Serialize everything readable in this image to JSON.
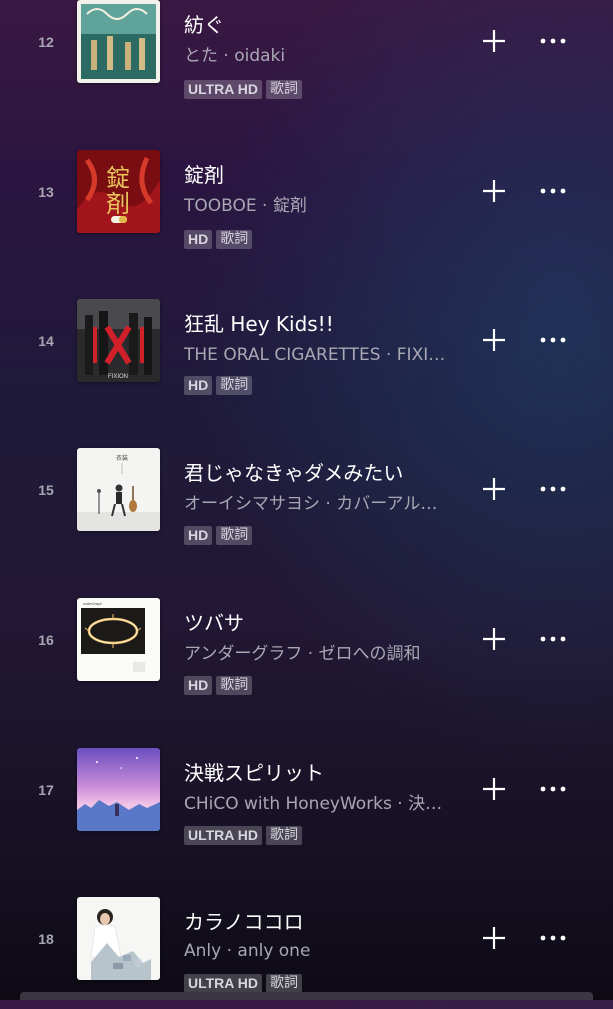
{
  "tracks": [
    {
      "number": "12",
      "title": "紡ぐ",
      "subtitle": "とた · oidaki",
      "quality": "ULTRA HD",
      "lyrics": "歌詞",
      "art": "album-art-oidaki"
    },
    {
      "number": "13",
      "title": "錠剤",
      "subtitle": "TOOBOE · 錠剤",
      "quality": "HD",
      "lyrics": "歌詞",
      "art": "album-art-joza"
    },
    {
      "number": "14",
      "title": "狂乱 Hey Kids!!",
      "subtitle": "THE ORAL CIGARETTES · FIXION",
      "quality": "HD",
      "lyrics": "歌詞",
      "art": "album-art-fixion"
    },
    {
      "number": "15",
      "title": "君じゃなきゃダメみたい",
      "subtitle": "オーイシマサヨシ · カバーアルバム",
      "quality": "HD",
      "lyrics": "歌詞",
      "art": "album-art-guitarist"
    },
    {
      "number": "16",
      "title": "ツバサ",
      "subtitle": "アンダーグラフ · ゼロへの調和",
      "quality": "HD",
      "lyrics": "歌詞",
      "art": "album-art-sparkler-ring"
    },
    {
      "number": "17",
      "title": "決戦スピリット",
      "subtitle": "CHiCO with HoneyWorks · 決戦スピリット",
      "quality": "ULTRA HD",
      "lyrics": "歌詞",
      "art": "album-art-anime-night"
    },
    {
      "number": "18",
      "title": "カラノココロ",
      "subtitle": "Anly · anly one",
      "quality": "ULTRA HD",
      "lyrics": "歌詞",
      "art": "album-art-anly"
    }
  ],
  "icons": {
    "add": "plus-icon",
    "more": "more-horizontal-icon"
  },
  "colors": {
    "text_primary": "#ffffff",
    "text_secondary": "#a9a7b4",
    "badge_bg": "#4a4654"
  }
}
